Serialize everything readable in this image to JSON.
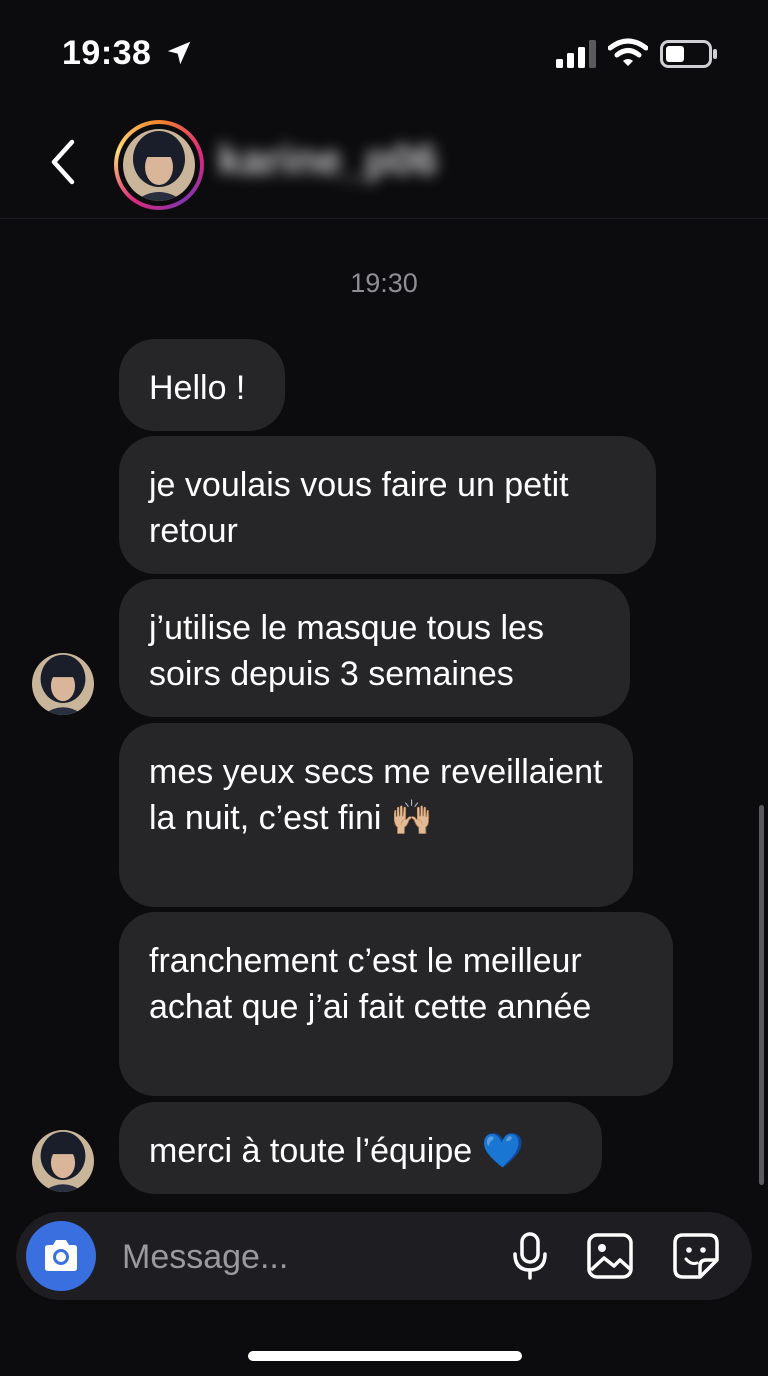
{
  "status_bar": {
    "time": "19:38",
    "icons": [
      "location-arrow-icon",
      "signal-icon",
      "wifi-icon",
      "battery-icon"
    ]
  },
  "header": {
    "username": "karine_p06",
    "icons": [
      "back-chevron-icon",
      "avatar"
    ]
  },
  "conversation": {
    "timestamp": "19:30",
    "messages": [
      {
        "text": "Hello !"
      },
      {
        "text": "je voulais vous faire un petit retour"
      },
      {
        "text": "j’utilise le masque tous les soirs depuis 3 semaines"
      },
      {
        "text": "mes yeux secs me reveillaient la nuit, c’est fini 🙌🏼"
      },
      {
        "text": "franchement c’est le meilleur achat que j’ai fait cette année"
      },
      {
        "text": "merci à toute l’équipe 💙"
      }
    ]
  },
  "composer": {
    "placeholder": "Message...",
    "icons": [
      "camera-icon",
      "microphone-icon",
      "gallery-icon",
      "sticker-icon"
    ]
  },
  "colors": {
    "background": "#0c0c0e",
    "bubble": "#262628",
    "camera_button": "#3a6fe0",
    "timestamp": "#8e8e93"
  }
}
